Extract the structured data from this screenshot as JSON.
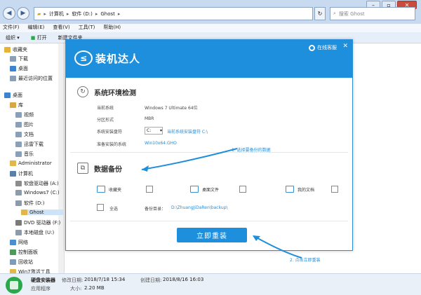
{
  "explorer": {
    "breadcrumb": [
      "计算机",
      "软件 (D:)",
      "Ghost"
    ],
    "search_placeholder": "搜索 Ghost",
    "menu": [
      "文件(F)",
      "编辑(E)",
      "查看(V)",
      "工具(T)",
      "帮助(H)"
    ],
    "toolbar": [
      "组织 ▾",
      "打开",
      "新建文件夹"
    ],
    "sidebar": [
      {
        "label": "收藏夹",
        "level": 0,
        "icon": "star-icon"
      },
      {
        "label": "下载",
        "level": 1,
        "icon": "download-folder-icon"
      },
      {
        "label": "桌面",
        "level": 1,
        "icon": "desktop-icon"
      },
      {
        "label": "最近访问的位置",
        "level": 1,
        "icon": "recent-places-icon"
      },
      {
        "label": "桌面",
        "level": 0,
        "icon": "desktop-icon"
      },
      {
        "label": "库",
        "level": 1,
        "icon": "library-icon"
      },
      {
        "label": "视频",
        "level": 2,
        "icon": "video-icon"
      },
      {
        "label": "图片",
        "level": 2,
        "icon": "pictures-icon"
      },
      {
        "label": "文档",
        "level": 2,
        "icon": "documents-icon"
      },
      {
        "label": "迅雷下载",
        "level": 2,
        "icon": "thunder-icon"
      },
      {
        "label": "音乐",
        "level": 2,
        "icon": "music-icon"
      },
      {
        "label": "Administrator",
        "level": 1,
        "icon": "user-folder-icon"
      },
      {
        "label": "计算机",
        "level": 1,
        "icon": "computer-icon"
      },
      {
        "label": "软盘驱动器 (A:)",
        "level": 2,
        "icon": "floppy-icon"
      },
      {
        "label": "Windows7 (C:)",
        "level": 2,
        "icon": "drive-icon"
      },
      {
        "label": "软件 (D:)",
        "level": 2,
        "icon": "drive-icon"
      },
      {
        "label": "Ghost",
        "level": 3,
        "icon": "folder-icon",
        "selected": true
      },
      {
        "label": "DVD 驱动器 (F:)",
        "level": 2,
        "icon": "dvd-icon"
      },
      {
        "label": "本地磁盘 (U:)",
        "level": 2,
        "icon": "drive-icon"
      },
      {
        "label": "网络",
        "level": 1,
        "icon": "network-icon"
      },
      {
        "label": "控制面板",
        "level": 1,
        "icon": "control-panel-icon"
      },
      {
        "label": "回收站",
        "level": 1,
        "icon": "recycle-bin-icon"
      },
      {
        "label": "Win7激活工具",
        "level": 1,
        "icon": "folder-icon"
      }
    ],
    "status": {
      "name": "硬盘安装器",
      "type": "应用程序",
      "modified_label": "修改日期:",
      "modified": "2018/7/18 15:34",
      "created_label": "创建日期:",
      "created": "2018/8/16 16:03",
      "size_label": "大小:",
      "size": "2.20 MB"
    }
  },
  "dialog": {
    "app_name": "装机达人",
    "online_service": "在线客服",
    "env": {
      "title": "系统环境检测",
      "rows": [
        {
          "label": "当前系统",
          "value": "Windows 7 Ultimate 64位"
        },
        {
          "label": "分区形式",
          "value": "MBR"
        },
        {
          "label": "系统安装盘符",
          "value": "C:",
          "link": "当前系统安装盘符 C:\\"
        },
        {
          "label": "准备安装的系统",
          "value": "Win10x64.GHO"
        }
      ]
    },
    "backup": {
      "title": "数据备份",
      "items": [
        "收藏夹",
        "桌面文件",
        "我的文档"
      ],
      "select_all": "全选",
      "dir_label": "备份目录：",
      "dir_value": "D:\\ZhuangJiDaRen\\backup\\"
    },
    "reinstall_button": "立即重装"
  },
  "annotations": {
    "step1": "1. 选择要备份的数据",
    "step2": "2. 点击立即重装"
  },
  "colors": {
    "accent": "#1e8fdc",
    "header": "#1e8fdc"
  }
}
